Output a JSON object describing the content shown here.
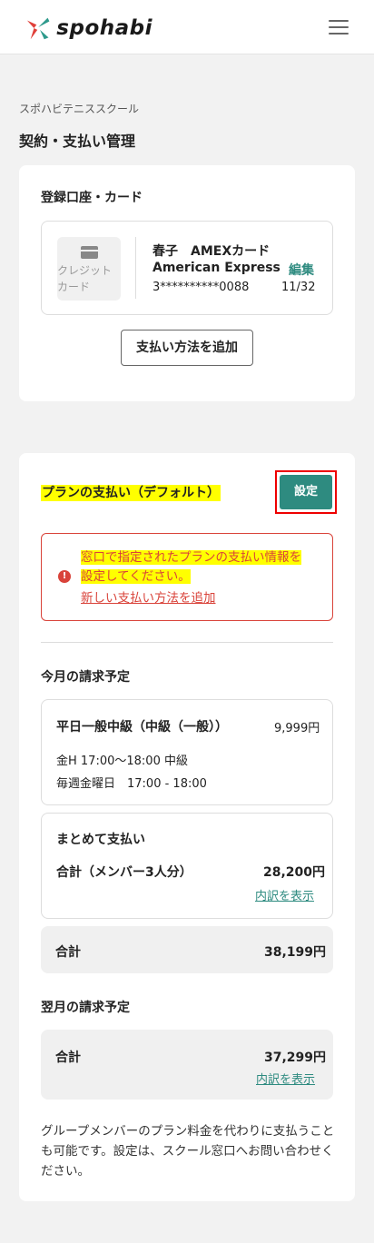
{
  "header": {
    "logo_text": "spohabi",
    "brand_colors": [
      "#e0403a",
      "#2e9a8c",
      "#222222"
    ]
  },
  "page": {
    "school_name": "スポハビテニススクール",
    "title": "契約・支払い管理"
  },
  "registered": {
    "section_title": "登録口座・カード",
    "payment": {
      "type_label": "クレジットカード",
      "holder": "春子　AMEXカード",
      "brand": "American Express",
      "number": "3**********0088",
      "expiry": "11/32",
      "edit_label": "編集"
    },
    "add_button_label": "支払い方法を追加"
  },
  "plan_payment": {
    "section_title": "プランの支払い（デフォルト）",
    "set_button_label": "設定",
    "alert": {
      "line1": "窓口で指定されたプランの支払い情報を",
      "line2": "設定してください。",
      "link_text": "新しい支払い方法を追加"
    },
    "this_month": {
      "title": "今月の請求予定",
      "plan_name": "平日一般中級（中級（一般））",
      "plan_price": "9,999円",
      "schedule1": "金H 17:00〜18:00 中級",
      "schedule2": "毎週金曜日　17:00 - 18:00",
      "group_title": "まとめて支払い",
      "group_total_label": "合計（メンバー3人分）",
      "group_total_value": "28,200円",
      "breakdown_link": "内訳を表示",
      "total_label": "合計",
      "total_value": "38,199円"
    },
    "next_month": {
      "title": "翌月の請求予定",
      "total_label": "合計",
      "total_value": "37,299円",
      "breakdown_link": "内訳を表示"
    },
    "note": "グループメンバーのプラン料金を代わりに支払うことも可能です。設定は、スクール窓口へお問い合わせください。"
  }
}
